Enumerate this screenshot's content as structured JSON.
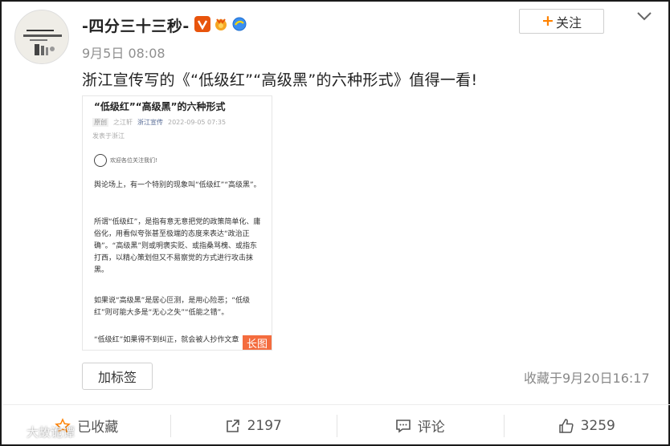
{
  "post": {
    "username": "-四分三十三秒-",
    "time": "9月5日 08:08",
    "follow_label": "关注",
    "text": "浙江宣传写的《“低级红”“高级黑”的六种形式》值得一看!",
    "badges": [
      "vip-v-icon",
      "gold-medal-icon",
      "blue-globe-icon"
    ]
  },
  "long_image": {
    "title": "“低级红”“高级黑”的六种形式",
    "meta_tag": "原创",
    "meta_author": "之江轩",
    "meta_source": "浙江宣传",
    "meta_date": "2022-09-05 07:35",
    "location": "发表于浙江",
    "follow_hint": "欢迎各位关注我们!",
    "paragraphs": [
      "舆论场上，有一个特别的现象叫“低级红”“高级黑”。",
      "所谓“低级红”，是指有意无意把党的政策简单化、庸俗化，用看似夸张甚至极端的态度来表达“政治正确”。“高级黑”则或明褒实贬、或指桑骂槐、或指东打西，以精心策划但又不易察觉的方式进行攻击抹黑。",
      "如果说“高级黑”是居心叵测，是用心险恶；“低级红”则可能大多是“无心之失”“低能之错”。",
      "“低级红”如果得不到纠正，就会被人抄作文章"
    ],
    "long_label": "长图"
  },
  "footer": {
    "tag_button": "加标签",
    "favorite_time": "收藏于9月20日16:17"
  },
  "actions": [
    {
      "icon": "star-icon",
      "label": "已收藏"
    },
    {
      "icon": "share-icon",
      "label": "2197"
    },
    {
      "icon": "comment-icon",
      "label": "评论"
    },
    {
      "icon": "thumbs-up-icon",
      "label": "3259"
    }
  ],
  "watermark": "大故诡谭",
  "colors": {
    "accent": "#ff8200",
    "long_label_bg": "#f46c3e",
    "link_blue": "#576b95"
  }
}
